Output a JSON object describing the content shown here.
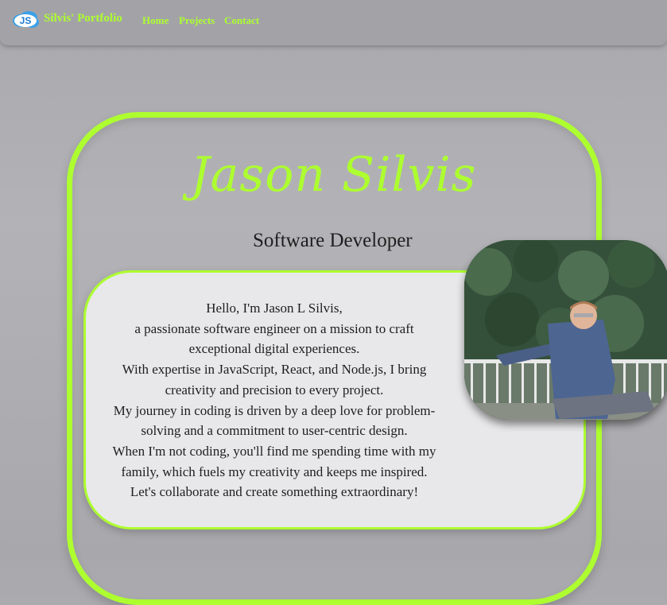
{
  "header": {
    "logo_text": "JS",
    "brand": "Silvis' Portfolio",
    "nav": [
      {
        "label": "Home"
      },
      {
        "label": "Projects"
      },
      {
        "label": "Contact"
      }
    ]
  },
  "hero": {
    "name": "Jason Silvis",
    "role": "Software Developer"
  },
  "about": {
    "lines": [
      "Hello, I'm Jason L Silvis,",
      "a passionate software engineer on a mission to craft",
      "exceptional digital experiences.",
      "With expertise in JavaScript, React, and Node.js, I bring",
      "creativity and precision to every project.",
      "My journey in coding is driven by a deep love for problem-",
      "solving and a commitment to user-centric design.",
      "When I'm not coding, you'll find me spending time with my",
      "family, which fuels my creativity and keeps me inspired.",
      "Let's collaborate and create something extraordinary!"
    ]
  },
  "colors": {
    "accent": "#adff2f",
    "background": "#adadb1",
    "card": "#e8e8ea",
    "text": "#1e1e1e"
  }
}
